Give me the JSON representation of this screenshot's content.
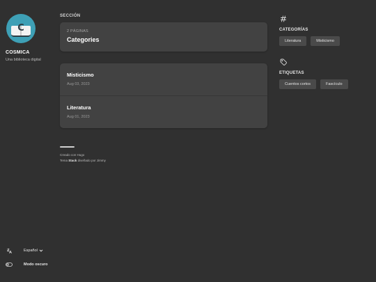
{
  "sidebar": {
    "site_title": "COSMICA",
    "site_description": "Una biblioteca digital",
    "avatar_letter": "C",
    "language": "Español",
    "dark_mode_label": "Modo oscuro"
  },
  "main": {
    "section_label": "SECCIÓN",
    "section_count": "2 PÁGINAS",
    "section_title": "Categories",
    "articles": [
      {
        "title": "Misticismo",
        "date": "Aug 03, 2023"
      },
      {
        "title": "Literatura",
        "date": "Aug 01, 2023"
      }
    ],
    "footer": {
      "line1": "Creado con Hugo",
      "theme_prefix": "Tema",
      "theme_name": "Stack",
      "theme_suffix": "diseñado por Jimmy"
    }
  },
  "right": {
    "categories_title": "CATEGORÍAS",
    "categories": [
      "Literatura",
      "Misticismo"
    ],
    "tags_title": "ETIQUETAS",
    "tags": [
      "Cuentos cortos",
      "Fascículo"
    ]
  },
  "colors": {
    "background": "#303030",
    "card": "#424242",
    "avatar": "#3ea0b6",
    "chip": "#4a4a4a"
  }
}
